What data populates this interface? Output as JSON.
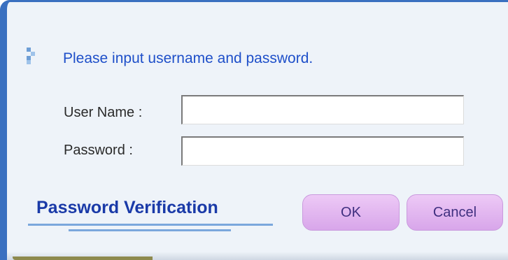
{
  "dialog": {
    "prompt": "Please input username and password.",
    "bullet_icon": "bullet-squares-icon"
  },
  "form": {
    "username_label": "User Name :",
    "username_value": "",
    "password_label": "Password :",
    "password_value": ""
  },
  "footer": {
    "brand_text": "Password Verification",
    "ok_label": "OK",
    "cancel_label": "Cancel"
  },
  "colors": {
    "dialog_bg": "#eef3f9",
    "frame_blue": "#3a70c0",
    "prompt_text": "#1e4fc9",
    "brand_text": "#1a3aa8",
    "button_bg": "#e3b9f1"
  }
}
